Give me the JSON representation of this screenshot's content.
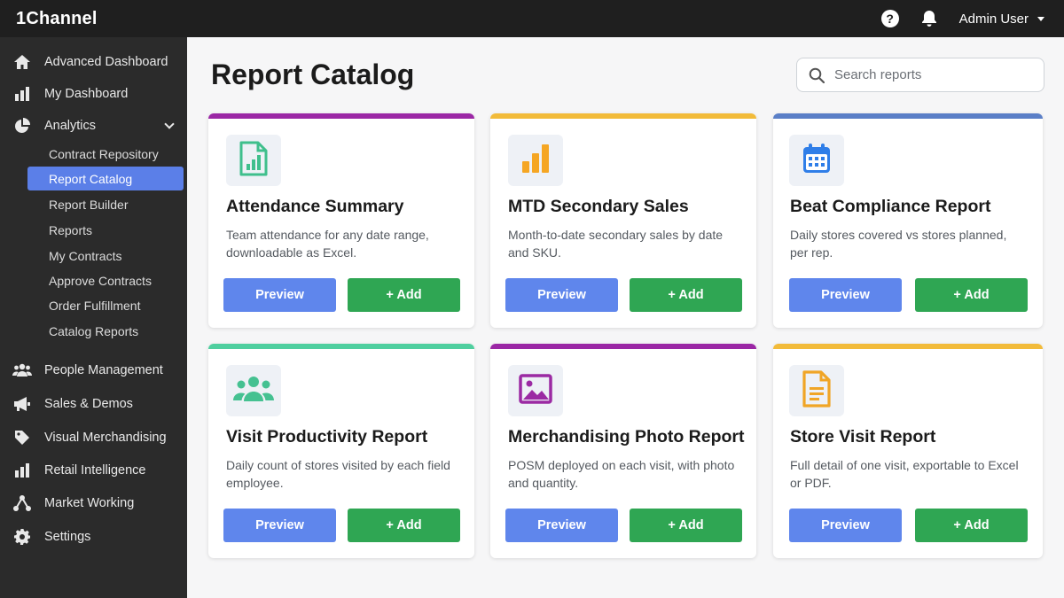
{
  "app": {
    "brand": "1Channel"
  },
  "topbar": {
    "help_glyph": "?",
    "user_name": "Admin User"
  },
  "sidebar": {
    "items": [
      {
        "label": "Advanced Dashboard",
        "icon": "home-icon"
      },
      {
        "label": "My Dashboard",
        "icon": "bar-chart-icon"
      },
      {
        "label": "Analytics",
        "icon": "pie-chart-icon",
        "expanded": true
      },
      {
        "label": "People Management",
        "icon": "users-icon"
      },
      {
        "label": "Sales & Demos",
        "icon": "megaphone-icon"
      },
      {
        "label": "Visual Merchandising",
        "icon": "tag-icon"
      },
      {
        "label": "Retail Intelligence",
        "icon": "bar-chart-icon"
      },
      {
        "label": "Market Working",
        "icon": "network-icon"
      },
      {
        "label": "Settings",
        "icon": "gear-icon"
      }
    ],
    "analytics_sub": [
      {
        "label": "Contract Repository"
      },
      {
        "label": "Report Catalog",
        "active": true
      },
      {
        "label": "Report Builder"
      },
      {
        "label": "Reports"
      },
      {
        "label": "My Contracts"
      },
      {
        "label": "Approve Contracts"
      },
      {
        "label": "Order Fulfillment"
      },
      {
        "label": "Catalog Reports"
      }
    ]
  },
  "main": {
    "title": "Report Catalog",
    "search": {
      "placeholder": "Search reports",
      "value": ""
    },
    "preview_label": "Preview",
    "add_label": "+ Add",
    "cards": [
      {
        "title": "Attendance Summary",
        "desc": "Team attendance for any date range, downloadable as Excel.",
        "accent": "#9b27a5",
        "icon": "spreadsheet-icon",
        "icon_color": "#3fbf8c"
      },
      {
        "title": "MTD Secondary Sales",
        "desc": "Month-to-date secondary sales by date and SKU.",
        "accent": "#f2bb3a",
        "icon": "bar-chart-icon",
        "icon_color": "#f5a623"
      },
      {
        "title": "Beat Compliance Report",
        "desc": "Daily stores covered vs stores planned, per rep.",
        "accent": "#5b7fc7",
        "icon": "calendar-icon",
        "icon_color": "#2f7ee8"
      },
      {
        "title": "Visit Productivity Report",
        "desc": "Daily count of stores visited by each field employee.",
        "accent": "#4fcf9f",
        "icon": "users-icon",
        "icon_color": "#45c191"
      },
      {
        "title": "Merchandising Photo Report",
        "desc": "POSM deployed on each visit, with photo and quantity.",
        "accent": "#9b27a5",
        "icon": "image-icon",
        "icon_color": "#9b2aa3"
      },
      {
        "title": "Store Visit Report",
        "desc": "Full detail of one visit, exportable to Excel or PDF.",
        "accent": "#f2bb3a",
        "icon": "document-icon",
        "icon_color": "#f0a526"
      }
    ]
  }
}
